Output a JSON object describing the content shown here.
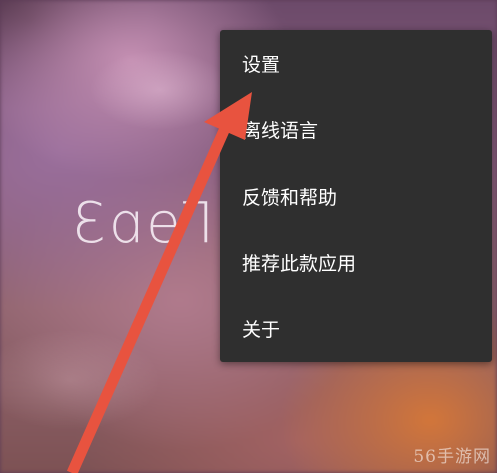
{
  "background": {
    "description_icon": "blurred-camera-preview"
  },
  "logo": {
    "text": "Γɘɒ3"
  },
  "menu": {
    "items": [
      {
        "label": "设置"
      },
      {
        "label": "离线语言"
      },
      {
        "label": "反馈和帮助"
      },
      {
        "label": "推荐此款应用"
      },
      {
        "label": "关于"
      }
    ]
  },
  "annotation": {
    "icon": "red-arrow-icon",
    "color": "#e8533f"
  },
  "watermark": {
    "text": "56手游网"
  }
}
